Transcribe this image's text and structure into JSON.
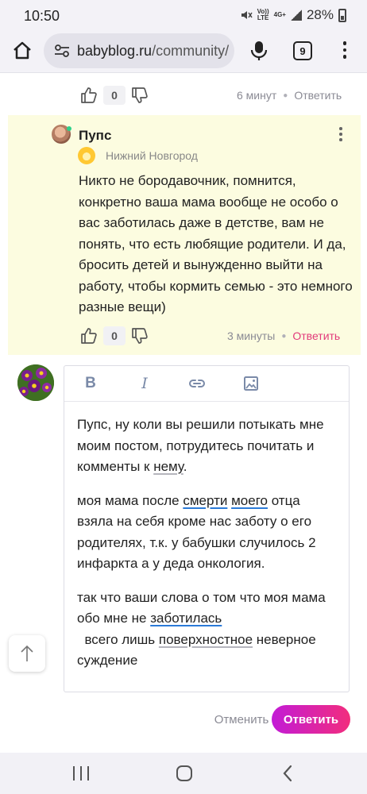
{
  "status_bar": {
    "time": "10:50",
    "network_top": "Vo))",
    "network_bottom": "LTE",
    "net_type": "4G+",
    "battery": "28%"
  },
  "browser": {
    "url_domain": "babyblog.ru",
    "url_path": "/community/",
    "tab_count": "9"
  },
  "prev_comment": {
    "likes": "0",
    "time": "6 минут",
    "reply_label": "Ответить"
  },
  "comment": {
    "author": "Пупс",
    "city": "Нижний Новгород",
    "text": "Никто не бородавочник, помнится, конкретно ваша мама вообще не особо о вас заботилась даже в детстве, вам не понять, что есть любящие родители. И да, бросить детей и вынужденно выйти на работу, чтобы кормить семью - это немного разные вещи)",
    "likes": "0",
    "time": "3 минуты",
    "reply_label": "Ответить"
  },
  "reply_form": {
    "toolbar": {
      "bold": "B",
      "italic": "I"
    },
    "para1": {
      "a": "Пупс, ну коли вы решили потыкать мне моим постом, потрудитесь почитать и комменты к ",
      "u1": "нему",
      "b": "."
    },
    "para2": {
      "a": "моя мама после ",
      "u1": "смерти",
      "sp": " ",
      "u2": "моего",
      "b": " отца взяла на себя кроме нас заботу о его родителях, т.к. у бабушки случилось 2 инфаркта а у деда онкология."
    },
    "para3": {
      "a": "так что ваши слова о том что моя мама обо мне не ",
      "u1": "заботилась",
      "b": "  всего лишь ",
      "u2": "поверхностное",
      "c": " неверное суждение"
    },
    "cancel_label": "Отменить",
    "submit_label": "Ответить"
  },
  "colors": {
    "accent": "#e23a7a",
    "comment_bg": "#fcfce0",
    "button_gradient_start": "#c21bd6",
    "button_gradient_end": "#f22d7d"
  },
  "icons": {
    "home": "home-icon",
    "site_settings": "tune-icon",
    "mic": "mic-icon",
    "menu": "more-vert-icon",
    "like": "thumbs-up-icon",
    "dislike": "thumbs-down-icon",
    "link": "link-icon",
    "image": "image-icon",
    "scroll_top": "arrow-up-icon"
  }
}
